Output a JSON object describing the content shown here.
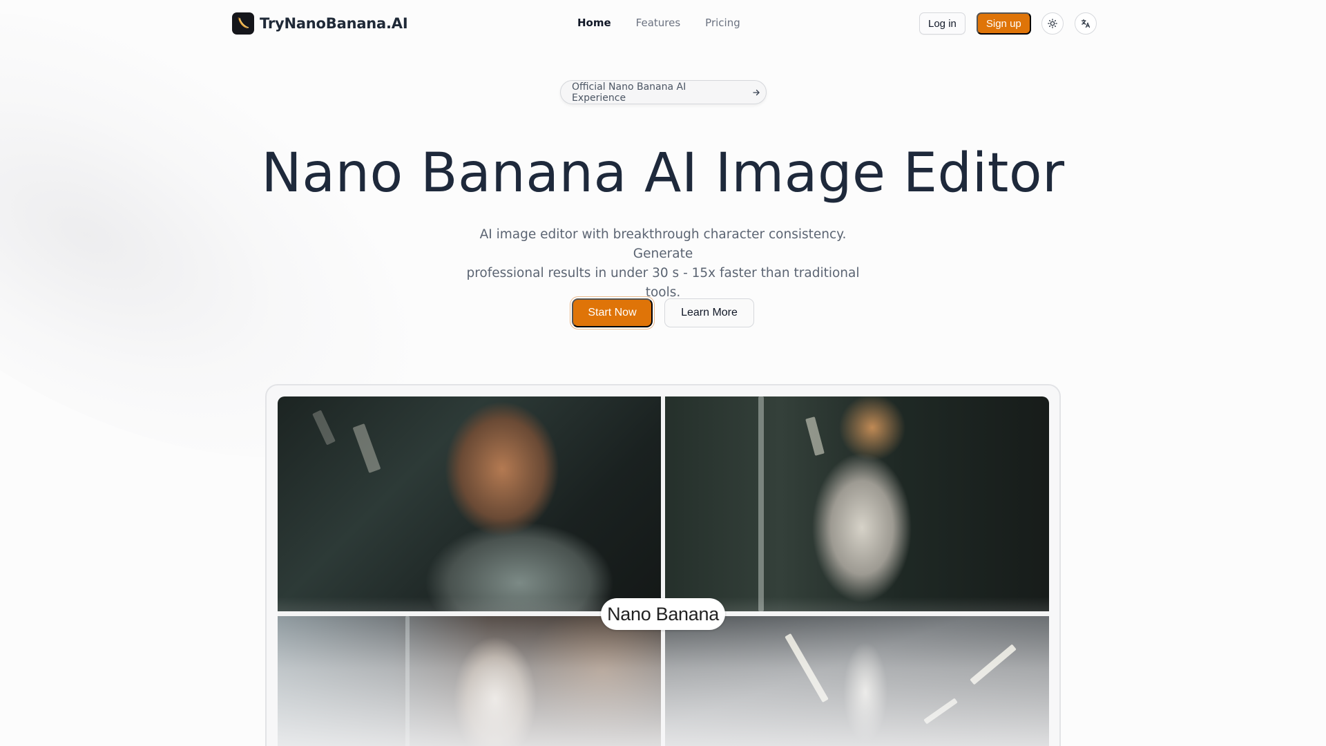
{
  "brand": {
    "name": "TryNanoBanana.AI",
    "logo_icon": "banana-logo-icon"
  },
  "nav": {
    "links": [
      {
        "label": "Home",
        "active": true
      },
      {
        "label": "Features",
        "active": false
      },
      {
        "label": "Pricing",
        "active": false
      }
    ],
    "login_label": "Log in",
    "signup_label": "Sign up",
    "theme_icon": "sun-icon",
    "language_icon": "translate-icon"
  },
  "badge": {
    "text": "Official Nano Banana AI Experience",
    "icon": "arrow-right-icon"
  },
  "hero": {
    "title": "Nano Banana AI Image Editor",
    "subtitle_line1": "AI image editor with breakthrough character consistency. Generate",
    "subtitle_line2": "professional results in under 30 s - 15x faster than traditional tools.",
    "primary_cta": "Start Now",
    "secondary_cta": "Learn More"
  },
  "showcase": {
    "label": "Nano Banana",
    "tiles": [
      "portrait-closeup",
      "subway-standing-phone",
      "cafe-window",
      "subway-platform"
    ]
  },
  "colors": {
    "accent": "#df7408",
    "heading": "#1e293b",
    "muted": "#5b6472"
  }
}
